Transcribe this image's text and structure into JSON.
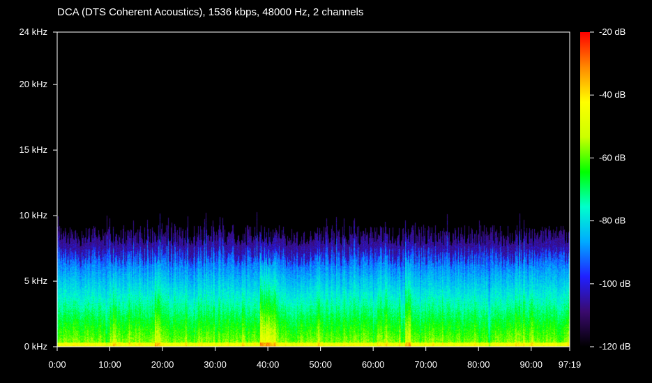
{
  "chart_data": {
    "type": "heatmap",
    "title": "DCA (DTS Coherent Acoustics), 1536 kbps, 48000 Hz, 2 channels",
    "x_tick_labels": [
      "0:00",
      "10:00",
      "20:00",
      "30:00",
      "40:00",
      "50:00",
      "60:00",
      "70:00",
      "80:00",
      "90:00",
      "97:19"
    ],
    "x_tick_minutes": [
      0,
      10,
      20,
      30,
      40,
      50,
      60,
      70,
      80,
      90,
      97.3167
    ],
    "x_range_minutes": [
      0,
      97.3167
    ],
    "y_tick_labels": [
      "0 kHz",
      "5 kHz",
      "10 kHz",
      "15 kHz",
      "20 kHz",
      "24 kHz"
    ],
    "y_tick_khz": [
      0,
      5,
      10,
      15,
      20,
      24
    ],
    "y_range_khz": [
      0,
      24
    ],
    "colorbar": {
      "tick_labels": [
        "-20 dB",
        "-40 dB",
        "-60 dB",
        "-80 dB",
        "-100 dB",
        "-120 dB"
      ],
      "tick_db": [
        -20,
        -40,
        -60,
        -80,
        -100,
        -120
      ],
      "range_db": [
        -120,
        -20
      ],
      "colors": [
        "#000000",
        "#3a0a6e",
        "#2020ff",
        "#00aaff",
        "#00ffcc",
        "#00ff00",
        "#ccff00",
        "#ffff00",
        "#ff8800",
        "#ff0000"
      ]
    },
    "energy_profile": {
      "description_free": true,
      "freq_cutoff_khz_typical": 8.5,
      "freq_cutoff_khz_max": 9.5,
      "loud_regions_minutes": [
        [
          38.5,
          41.5
        ],
        [
          18.5,
          19.5
        ],
        [
          66,
          67
        ]
      ]
    },
    "grid": false
  }
}
